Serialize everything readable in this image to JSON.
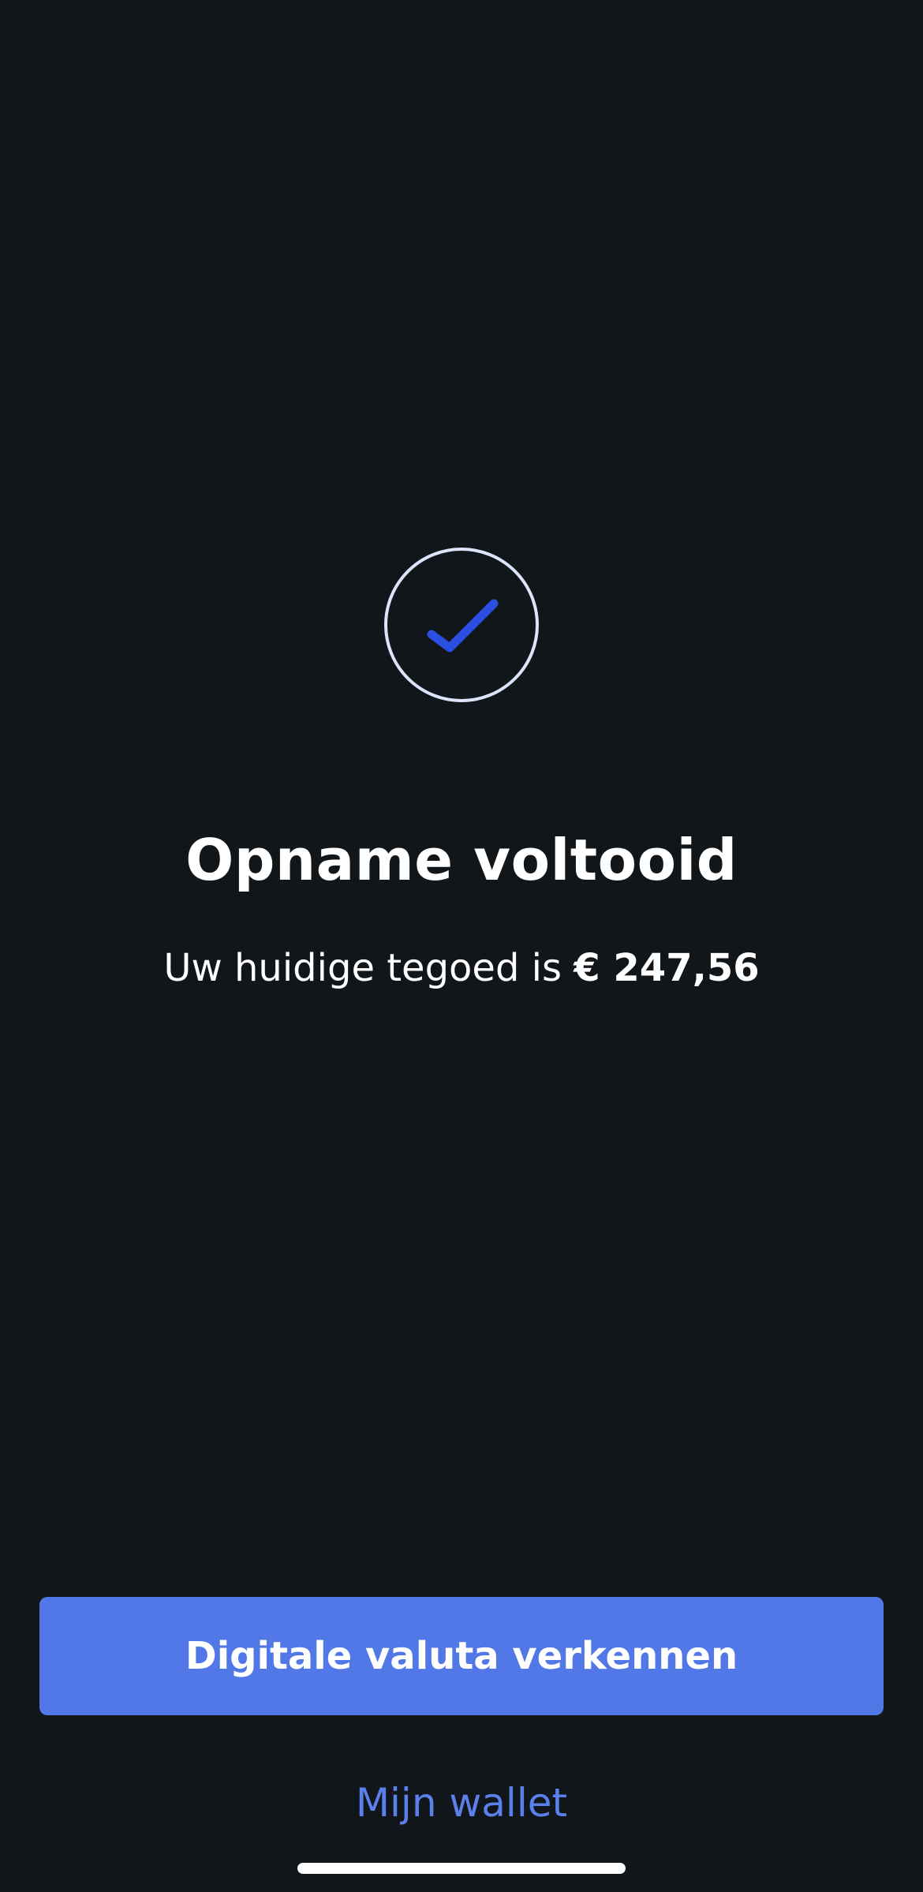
{
  "success": {
    "icon": "checkmark-circle-icon",
    "ring_color": "#dbe4fb",
    "check_color": "#2b4fe0"
  },
  "title": "Opname voltooid",
  "subtitle": {
    "prefix": "Uw huidige tegoed is",
    "amount": "€ 247,56"
  },
  "actions": {
    "primary_label": "Digitale valuta verkennen",
    "secondary_label": "Mijn wallet"
  },
  "colors": {
    "background": "#11161b",
    "primary_button": "#5278e8",
    "link": "#5b80ec"
  }
}
